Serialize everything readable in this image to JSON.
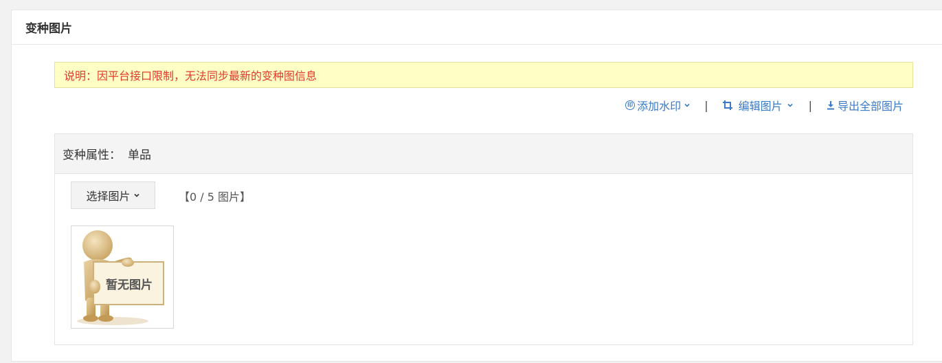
{
  "panel": {
    "title": "变种图片"
  },
  "notice": {
    "text": "说明：因平台接口限制，无法同步最新的变种图信息"
  },
  "toolbar": {
    "watermark_label": "添加水印",
    "edit_label": "编辑图片",
    "export_label": "导出全部图片",
    "separator": "|",
    "link_color": "#3a7ac6"
  },
  "variant": {
    "attr_label": "变种属性：",
    "attr_value": "单品",
    "select_button_label": "选择图片",
    "image_count": "【0 / 5 图片】",
    "placeholder_text": "暂无图片"
  },
  "colors": {
    "notice_bg": "#ffffc5",
    "notice_text": "#e03a2c",
    "header_bg": "#f4f4f4"
  }
}
